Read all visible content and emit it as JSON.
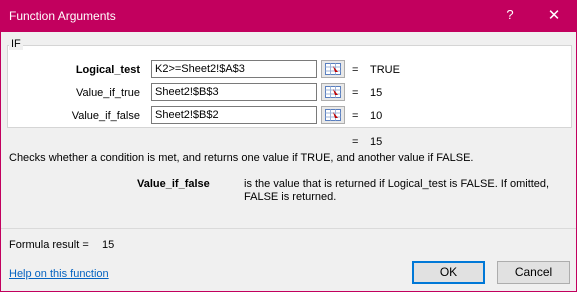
{
  "window": {
    "title": "Function Arguments",
    "help_glyph": "?",
    "close_glyph": "✕"
  },
  "function_name": "IF",
  "arguments": [
    {
      "label": "Logical_test",
      "value": "K2>=Sheet2!$A$3",
      "equals": "=",
      "result": "TRUE",
      "bold": true
    },
    {
      "label": "Value_if_true",
      "value": "Sheet2!$B$3",
      "equals": "=",
      "result": "15",
      "bold": false
    },
    {
      "label": "Value_if_false",
      "value": "Sheet2!$B$2",
      "equals": "=",
      "result": "10",
      "bold": false
    }
  ],
  "overall_result": {
    "equals": "=",
    "value": "15"
  },
  "description": "Checks whether a condition is met, and returns one value if TRUE, and another value if FALSE.",
  "argument_help": {
    "name": "Value_if_false",
    "text": "is the value that is returned if Logical_test is FALSE. If omitted, FALSE is returned."
  },
  "formula_result": {
    "label": "Formula result =",
    "value": "15"
  },
  "help_link": "Help on this function",
  "buttons": {
    "ok": "OK",
    "cancel": "Cancel"
  },
  "colors": {
    "titlebar": "#c2005e",
    "link": "#0563c1",
    "default_button_border": "#0078d7"
  }
}
